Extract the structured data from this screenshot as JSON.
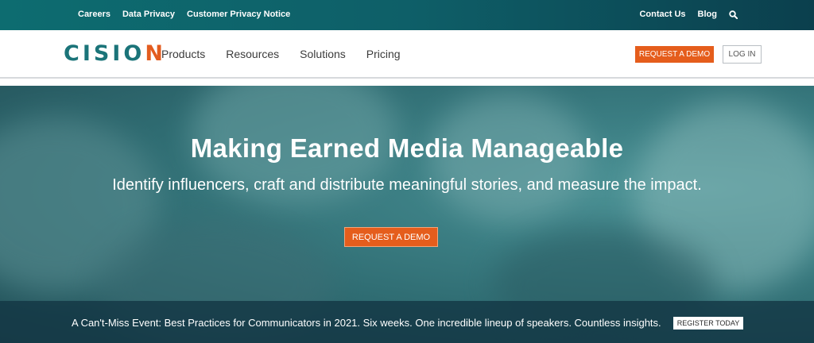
{
  "topbar": {
    "left_links": [
      "Careers",
      "Data Privacy",
      "Customer Privacy Notice"
    ],
    "contact_label": "Contact Us",
    "blog_label": "Blog",
    "search_icon": "search-icon"
  },
  "header": {
    "logo_text": "CISIO",
    "logo_o": "N",
    "nav_items": [
      "Products",
      "Resources",
      "Solutions",
      "Pricing"
    ],
    "request_demo_label": "REQUEST A DEMO",
    "login_label": "LOG IN"
  },
  "hero": {
    "title": "Making Earned Media Manageable",
    "subtitle": "Identify influencers, craft and distribute meaningful stories, and measure the impact.",
    "cta_label": "REQUEST A DEMO"
  },
  "announcement": {
    "text": "A Can't-Miss Event: Best Practices for Communicators in 2021. Six weeks. One incredible lineup of speakers. Countless insights.",
    "button_label": "REGISTER TODAY"
  },
  "colors": {
    "brand_teal": "#1b7479",
    "accent_orange": "#e55d1c"
  }
}
